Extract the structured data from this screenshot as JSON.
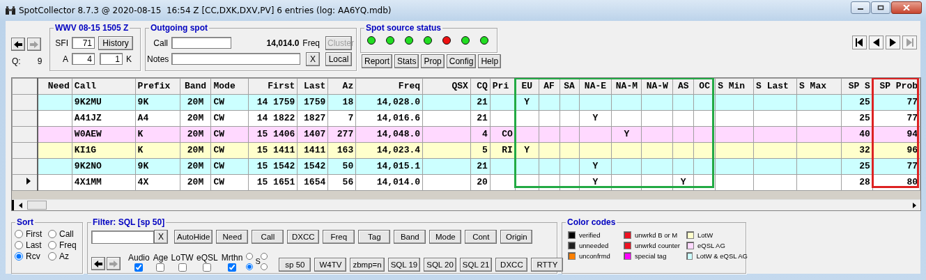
{
  "window": {
    "title": "SpotCollector 8.7.3 @ 2020-08-15  16:54 Z [CC,DXK,DXV,PV] 6 entries (log: AA6YQ.mdb)"
  },
  "history_nav": [
    {
      "kind": "back",
      "disabled": false
    },
    {
      "kind": "forward",
      "disabled": true
    }
  ],
  "queue": {
    "label": "Q:",
    "value": "9"
  },
  "wwv": {
    "title": "WWV 08-15 1505 Z",
    "sfi_label": "SFI",
    "sfi": "71",
    "history_button": "History",
    "a_label": "A",
    "a": "4",
    "k": "1",
    "k_label": "K"
  },
  "outgoing_spot": {
    "title": "Outgoing spot",
    "call_label": "Call",
    "frequency": "14,014.0",
    "freq_label": "Freq",
    "notes_label": "Notes",
    "clear_button": "X",
    "buttons": [
      {
        "label": "Cluster",
        "disabled": true
      },
      {
        "label": "Local",
        "disabled": false
      }
    ]
  },
  "spot_source_status": {
    "title": "Spot source status",
    "sources": [
      {
        "color": "#22dd22"
      },
      {
        "color": "#22dd22"
      },
      {
        "color": "#22dd22"
      },
      {
        "color": "#22dd22"
      },
      {
        "color": "#ee1111"
      },
      {
        "color": "#22dd22"
      },
      {
        "color": "#22dd22"
      }
    ]
  },
  "tool_buttons": [
    "Report",
    "Stats",
    "Prop",
    "Config",
    "Help"
  ],
  "record_nav": [
    {
      "kind": "first",
      "disabled": false
    },
    {
      "kind": "previous",
      "disabled": false
    },
    {
      "kind": "next",
      "disabled": false
    },
    {
      "kind": "last",
      "disabled": true
    }
  ],
  "table": {
    "columns": [
      {
        "label": "Need"
      },
      {
        "label": "Call"
      },
      {
        "label": "Prefix"
      },
      {
        "label": "Band"
      },
      {
        "label": "Mode"
      },
      {
        "label": "First"
      },
      {
        "label": "Last"
      },
      {
        "label": "Az"
      },
      {
        "label": "Freq"
      },
      {
        "label": "QSX"
      },
      {
        "label": "CQ"
      },
      {
        "label": "Pri"
      },
      {
        "label": "EU",
        "color": "#22aa44"
      },
      {
        "label": "AF",
        "color": "#22aa44"
      },
      {
        "label": "SA",
        "color": "#22aa44"
      },
      {
        "label": "NA-E",
        "color": "#22aa44"
      },
      {
        "label": "NA-M",
        "color": "#22aa44"
      },
      {
        "label": "NA-W",
        "color": "#22aa44"
      },
      {
        "label": "AS",
        "color": "#22aa44"
      },
      {
        "label": "OC",
        "color": "#22aa44"
      },
      {
        "label": "S Min"
      },
      {
        "label": "S Last"
      },
      {
        "label": "S Max"
      },
      {
        "label": "SP S"
      },
      {
        "label": "SP Prob",
        "color": "#dd2222"
      }
    ],
    "rows": [
      {
        "color": "#ccffff",
        "current": false,
        "cells": [
          null,
          "9K2MU",
          "9K",
          "20M",
          "CW",
          "14 1759",
          "1759",
          "18",
          "14,028.0",
          null,
          "21",
          null,
          "Y",
          null,
          null,
          null,
          null,
          null,
          null,
          null,
          null,
          null,
          null,
          "25",
          "77"
        ]
      },
      {
        "color": "#ffffff",
        "current": false,
        "cells": [
          null,
          "A41JZ",
          "A4",
          "20M",
          "CW",
          "14 1822",
          "1827",
          "7",
          "14,016.6",
          null,
          "21",
          null,
          null,
          null,
          null,
          "Y",
          null,
          null,
          null,
          null,
          null,
          null,
          null,
          "25",
          "77"
        ]
      },
      {
        "color": "#ffd9ff",
        "current": false,
        "cells": [
          null,
          "W0AEW",
          "K",
          "20M",
          "CW",
          "15 1406",
          "1407",
          "277",
          "14,048.0",
          null,
          "4",
          "CO",
          null,
          null,
          null,
          null,
          "Y",
          null,
          null,
          null,
          null,
          null,
          null,
          "40",
          "94"
        ]
      },
      {
        "color": "#ffffcc",
        "current": false,
        "cells": [
          null,
          "KI1G",
          "K",
          "20M",
          "CW",
          "15 1411",
          "1411",
          "163",
          "14,023.4",
          null,
          "5",
          "RI",
          "Y",
          null,
          null,
          null,
          null,
          null,
          null,
          null,
          null,
          null,
          null,
          "32",
          "96"
        ]
      },
      {
        "color": "#ccffff",
        "current": false,
        "cells": [
          null,
          "9K2NO",
          "9K",
          "20M",
          "CW",
          "15 1542",
          "1542",
          "50",
          "14,015.1",
          null,
          "21",
          null,
          null,
          null,
          null,
          "Y",
          null,
          null,
          null,
          null,
          null,
          null,
          null,
          "25",
          "77"
        ]
      },
      {
        "color": "#ffffff",
        "current": true,
        "cells": [
          null,
          "4X1MM",
          "4X",
          "20M",
          "CW",
          "15 1651",
          "1654",
          "56",
          "14,014.0",
          null,
          "20",
          null,
          null,
          null,
          null,
          "Y",
          null,
          null,
          "Y",
          null,
          null,
          null,
          null,
          "28",
          "80"
        ]
      }
    ]
  },
  "sort": {
    "title": "Sort",
    "options": [
      {
        "label": "First",
        "selected": false
      },
      {
        "label": "Call",
        "selected": false
      },
      {
        "label": "Last",
        "selected": false
      },
      {
        "label": "Freq",
        "selected": false
      },
      {
        "label": "Rcv",
        "selected": true
      },
      {
        "label": "Az",
        "selected": false
      }
    ]
  },
  "filter": {
    "title": "Filter: SQL [sp 50]",
    "clear_button": "X",
    "top_buttons": [
      "AutoHide",
      "Need",
      "Call",
      "DXCC",
      "Freq",
      "Tag",
      "Band",
      "Mode",
      "Cont",
      "Origin"
    ],
    "nav": [
      {
        "kind": "back",
        "disabled": false
      },
      {
        "kind": "forward",
        "disabled": true
      }
    ],
    "checkboxes": [
      {
        "label": "Audio",
        "checked": true
      },
      {
        "label": "Age",
        "checked": false
      },
      {
        "label": "LoTW",
        "checked": false
      },
      {
        "label": "eQSL",
        "checked": false
      },
      {
        "label": "Mrthn",
        "checked": true
      }
    ],
    "s_label": "S",
    "s_options": [
      {
        "selected": false
      },
      {
        "selected": false
      },
      {
        "selected": true
      },
      {
        "selected": false
      }
    ],
    "bottom_buttons": [
      "sp 50",
      "W4TV",
      "zbmp=n",
      "SQL 19",
      "SQL 20",
      "SQL 21",
      "DXCC",
      "RTTY"
    ]
  },
  "color_codes": {
    "title": "Color codes",
    "items": [
      {
        "label": "verified",
        "color": "#000000"
      },
      {
        "label": "unwrkd B or M",
        "color": "#ee1122"
      },
      {
        "label": "LotW",
        "color": "#ffffcc"
      },
      {
        "label": "unneeded",
        "color": "#202020"
      },
      {
        "label": "unwrkd counter",
        "color": "#ee1122"
      },
      {
        "label": "eQSL AG",
        "color": "#ffd9ff"
      },
      {
        "label": "unconfrmd",
        "color": "#ff8000"
      },
      {
        "label": "special tag",
        "color": "#ff00ff"
      },
      {
        "label": "LotW & eQSL AG",
        "color": "#ccffff"
      }
    ]
  }
}
